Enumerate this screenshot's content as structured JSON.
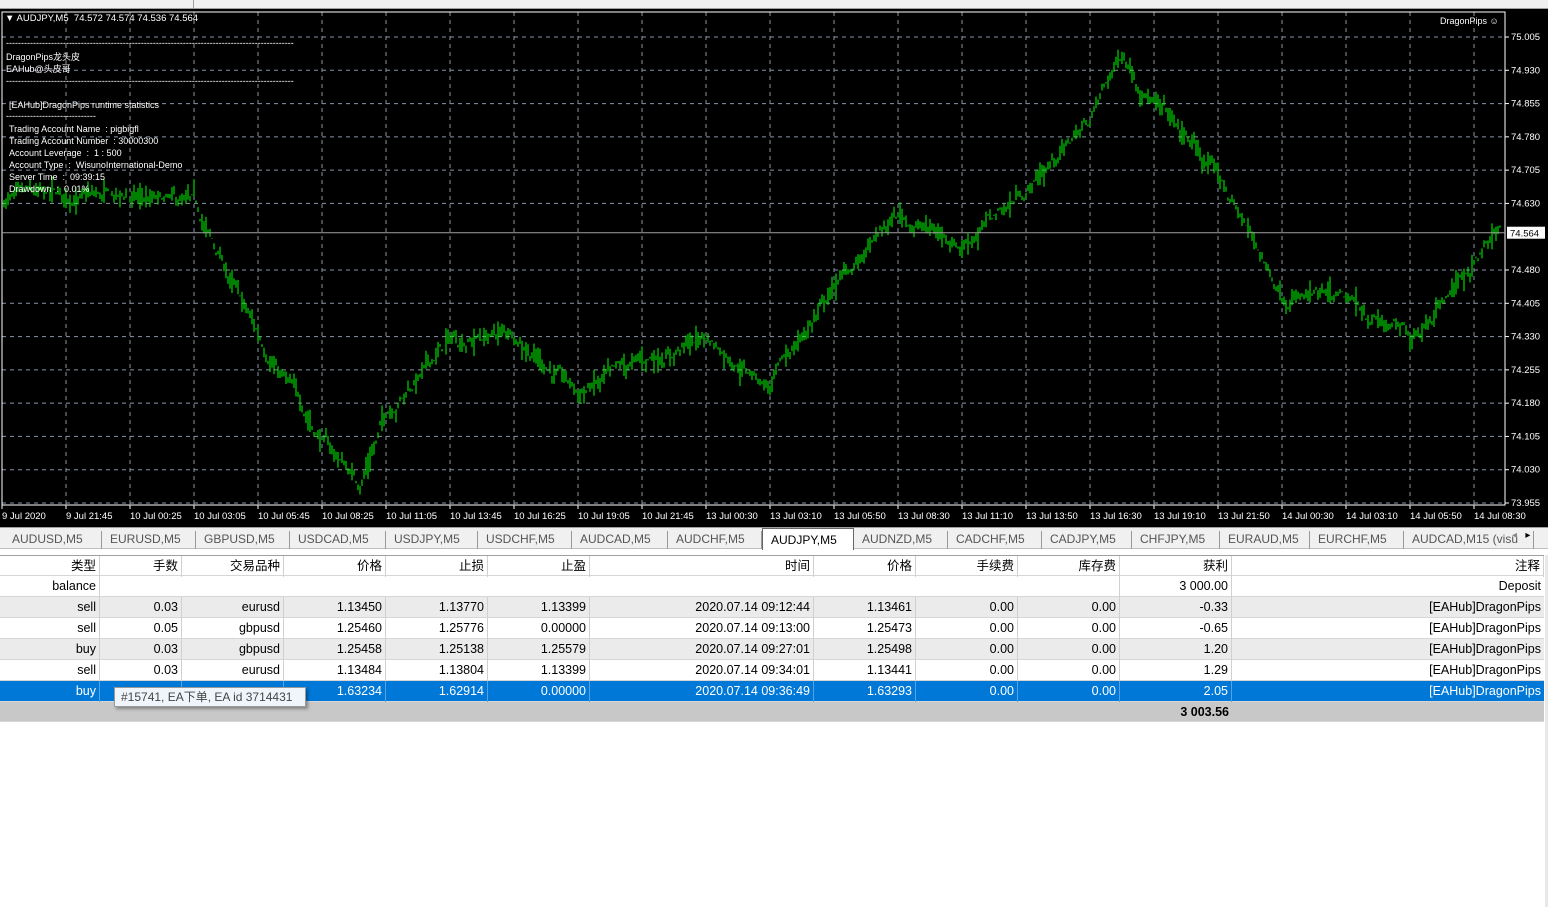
{
  "chart": {
    "header": {
      "symbol": "AUDJPY,M5",
      "ohlc": "74.572 74.574 74.536 74.564"
    },
    "brand": "DragonPips",
    "overlay": {
      "separator": "------------------------------------------------------------------------------------------------",
      "line1": "DragonPips龙头皮",
      "line2": "EAHub@头皮哥",
      "stats_title": "[EAHub]DragonPips runtime statistics",
      "stats_sep": "------------------------------",
      "account_name": "Trading Account Name  : pigbigfl",
      "account_number": "Trading Account Number  : 30000300",
      "leverage": "Account Leverage  :  1 : 500",
      "account_type": "Account Type  :  WisunoInternational-Demo",
      "server_time": "Server Time  :  09:39:15",
      "drawdown": "Drawdown  :  0.01%"
    },
    "colors": {
      "bars": "#00ff00",
      "grid": "#8a96a8",
      "background": "#000000"
    }
  },
  "chart_data": {
    "type": "ohlc-bar",
    "symbol": "AUDJPY",
    "timeframe": "M5",
    "current_price": "74.564",
    "y_ticks": [
      "75.005",
      "74.930",
      "74.855",
      "74.780",
      "74.705",
      "74.630",
      "74.480",
      "74.405",
      "74.330",
      "74.255",
      "74.180",
      "74.105",
      "74.030",
      "73.955"
    ],
    "ylim": [
      73.955,
      75.03
    ],
    "x_ticks": [
      "9 Jul 2020",
      "9 Jul 21:45",
      "10 Jul 00:25",
      "10 Jul 03:05",
      "10 Jul 05:45",
      "10 Jul 08:25",
      "10 Jul 11:05",
      "10 Jul 13:45",
      "10 Jul 16:25",
      "10 Jul 19:05",
      "10 Jul 21:45",
      "13 Jul 00:30",
      "13 Jul 03:10",
      "13 Jul 05:50",
      "13 Jul 08:30",
      "13 Jul 11:10",
      "13 Jul 13:50",
      "13 Jul 16:30",
      "13 Jul 19:10",
      "13 Jul 21:50",
      "14 Jul 00:30",
      "14 Jul 03:10",
      "14 Jul 05:50",
      "14 Jul 08:30"
    ],
    "approx_closes": [
      {
        "t": "9 Jul 2020",
        "v": 74.638
      },
      {
        "t": "9 Jul 21:45",
        "v": 74.64
      },
      {
        "t": "10 Jul 00:25",
        "v": 74.64
      },
      {
        "t": "10 Jul 03:05",
        "v": 74.62
      },
      {
        "t": "10 Jul 05:45",
        "v": 74.33
      },
      {
        "t": "10 Jul 08:25",
        "v": 74.1
      },
      {
        "t": "10 Jul 10:00",
        "v": 74.0
      },
      {
        "t": "10 Jul 11:05",
        "v": 74.16
      },
      {
        "t": "10 Jul 13:45",
        "v": 74.32
      },
      {
        "t": "10 Jul 16:25",
        "v": 74.34
      },
      {
        "t": "10 Jul 19:05",
        "v": 74.2
      },
      {
        "t": "10 Jul 21:45",
        "v": 74.27
      },
      {
        "t": "13 Jul 00:30",
        "v": 74.33
      },
      {
        "t": "13 Jul 03:10",
        "v": 74.22
      },
      {
        "t": "13 Jul 05:50",
        "v": 74.44
      },
      {
        "t": "13 Jul 08:30",
        "v": 74.6
      },
      {
        "t": "13 Jul 11:10",
        "v": 74.54
      },
      {
        "t": "13 Jul 13:50",
        "v": 74.66
      },
      {
        "t": "13 Jul 16:30",
        "v": 74.82
      },
      {
        "t": "13 Jul 17:50",
        "v": 74.97
      },
      {
        "t": "13 Jul 19:10",
        "v": 74.86
      },
      {
        "t": "13 Jul 21:50",
        "v": 74.69
      },
      {
        "t": "14 Jul 00:30",
        "v": 74.43
      },
      {
        "t": "14 Jul 03:10",
        "v": 74.4
      },
      {
        "t": "14 Jul 05:50",
        "v": 74.33
      },
      {
        "t": "14 Jul 08:30",
        "v": 74.5
      },
      {
        "t": "14 Jul 09:35",
        "v": 74.564
      }
    ]
  },
  "tabs": [
    "AUDUSD,M5",
    "EURUSD,M5",
    "GBPUSD,M5",
    "USDCAD,M5",
    "USDJPY,M5",
    "USDCHF,M5",
    "AUDCAD,M5",
    "AUDCHF,M5",
    "AUDJPY,M5",
    "AUDNZD,M5",
    "CADCHF,M5",
    "CADJPY,M5",
    "CHFJPY,M5",
    "EURAUD,M5",
    "EURCHF,M5",
    "AUDCAD,M15 (visu"
  ],
  "active_tab": "AUDJPY,M5",
  "table": {
    "headers": [
      "类型",
      "手数",
      "交易品种",
      "价格",
      "止损",
      "止盈",
      "时间",
      "价格",
      "手续费",
      "库存费",
      "获利",
      "注释"
    ],
    "balance_row": {
      "type": "balance",
      "profit": "3 000.00",
      "comment": "Deposit"
    },
    "rows": [
      [
        "sell",
        "0.03",
        "eurusd",
        "1.13450",
        "1.13770",
        "1.13399",
        "2020.07.14 09:12:44",
        "1.13461",
        "0.00",
        "0.00",
        "-0.33",
        "[EAHub]DragonPips"
      ],
      [
        "sell",
        "0.05",
        "gbpusd",
        "1.25460",
        "1.25776",
        "0.00000",
        "2020.07.14 09:13:00",
        "1.25473",
        "0.00",
        "0.00",
        "-0.65",
        "[EAHub]DragonPips"
      ],
      [
        "buy",
        "0.03",
        "gbpusd",
        "1.25458",
        "1.25138",
        "1.25579",
        "2020.07.14 09:27:01",
        "1.25498",
        "0.00",
        "0.00",
        "1.20",
        "[EAHub]DragonPips"
      ],
      [
        "sell",
        "0.03",
        "eurusd",
        "1.13484",
        "1.13804",
        "1.13399",
        "2020.07.14 09:34:01",
        "1.13441",
        "0.00",
        "0.00",
        "1.29",
        "[EAHub]DragonPips"
      ],
      [
        "buy",
        "",
        "",
        "1.63234",
        "1.62914",
        "0.00000",
        "2020.07.14 09:36:49",
        "1.63293",
        "0.00",
        "0.00",
        "2.05",
        "[EAHub]DragonPips"
      ]
    ],
    "total": "3 003.56",
    "selected_row": 4
  },
  "tooltip": "#15741, EA下单, EA id 3714431"
}
